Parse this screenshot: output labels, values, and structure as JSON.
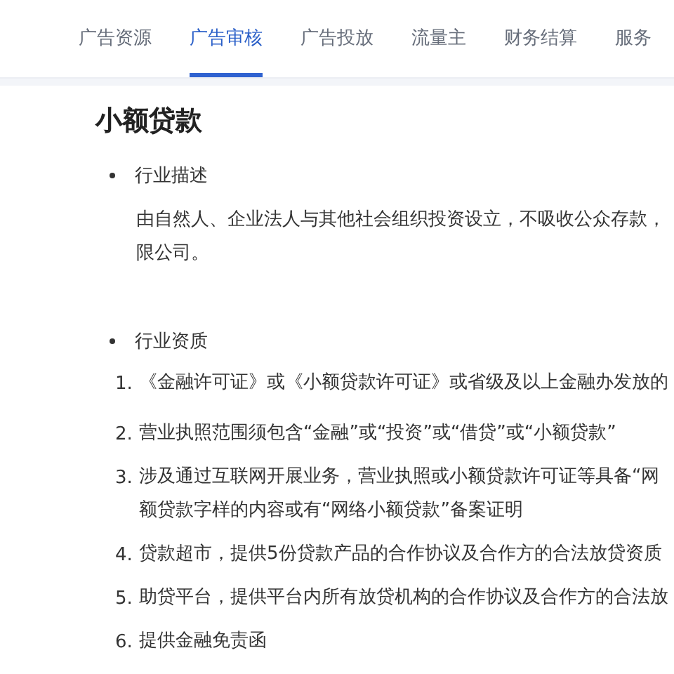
{
  "tabs": [
    {
      "label": "广告资源",
      "selected": false
    },
    {
      "label": "广告审核",
      "selected": true
    },
    {
      "label": "广告投放",
      "selected": false
    },
    {
      "label": "流量主",
      "selected": false
    },
    {
      "label": "财务结算",
      "selected": false
    },
    {
      "label": "服务",
      "selected": false
    }
  ],
  "title": "小额贷款",
  "sections": [
    {
      "heading": "行业描述",
      "paragraph": [
        "由自然人、企业法人与其他社会组织投资设立，不吸收公众存款，",
        "限公司。"
      ]
    },
    {
      "heading": "行业资质",
      "items": [
        {
          "number": "1.",
          "lines": [
            "《金融许可证》或《小额贷款许可证》或省级及以上金融办发放的"
          ]
        },
        {
          "number": "2.",
          "lines": [
            "营业执照范围须包含“金融”或“投资”或“借贷”或“小额贷款”"
          ]
        },
        {
          "number": "3.",
          "lines": [
            "涉及通过互联网开展业务，营业执照或小额贷款许可证等具备“网",
            "额贷款字样的内容或有“网络小额贷款”备案证明"
          ]
        },
        {
          "number": "4.",
          "lines": [
            "贷款超市，提供5份贷款产品的合作协议及合作方的合法放贷资质"
          ]
        },
        {
          "number": "5.",
          "lines": [
            "助贷平台，提供平台内所有放贷机构的合作协议及合作方的合法放"
          ]
        },
        {
          "number": "6.",
          "lines": [
            "提供金融免责函"
          ]
        }
      ]
    }
  ]
}
